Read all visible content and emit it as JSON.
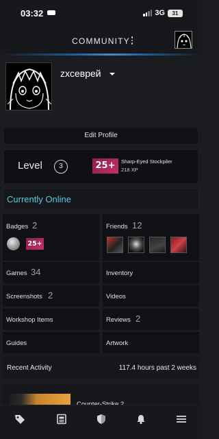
{
  "status_bar": {
    "time": "03:32",
    "network": "3G",
    "battery": "31",
    "icons": [
      "car-icon",
      "signal-icon",
      "battery-icon"
    ]
  },
  "header": {
    "title": "COMMUNITY",
    "icons": [
      "kebab-menu-icon",
      "profile-avatar-icon"
    ],
    "accent_color": "#1f78c8"
  },
  "profile": {
    "username": "zxcеврей",
    "edit_label": "Edit Profile"
  },
  "level": {
    "label": "Level",
    "value": "3",
    "badge_text": "25+",
    "badge_name": "Sharp-Eyed Stockpiler",
    "badge_xp": "218 XP",
    "badge_color": "#c42f67"
  },
  "online": {
    "label": "Currently Online",
    "color": "#57cbde"
  },
  "grid": {
    "badges": {
      "label": "Badges",
      "count": "2",
      "badge_text": "25+"
    },
    "friends": {
      "label": "Friends",
      "count": "12"
    },
    "games": {
      "label": "Games",
      "count": "34"
    },
    "inventory": {
      "label": "Inventory"
    },
    "screenshots": {
      "label": "Screenshots",
      "count": "2"
    },
    "videos": {
      "label": "Videos"
    },
    "workshop": {
      "label": "Workshop Items"
    },
    "reviews": {
      "label": "Reviews",
      "count": "2"
    },
    "guides": {
      "label": "Guides"
    },
    "artwork": {
      "label": "Artwork"
    }
  },
  "recent": {
    "label": "Recent Activity",
    "hours": "117.4 hours past 2 weeks",
    "game_name": "Counter-Strike 2"
  },
  "bottom_nav": {
    "items": [
      "tag-icon",
      "news-icon",
      "shield-icon",
      "bell-icon",
      "menu-icon"
    ]
  }
}
